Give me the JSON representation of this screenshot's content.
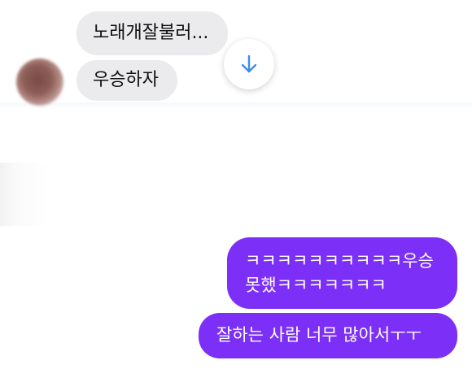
{
  "incoming": {
    "messages": [
      {
        "text": "노래개잘불러..."
      },
      {
        "text": "우승하자"
      }
    ]
  },
  "outgoing": {
    "messages": [
      {
        "lines": [
          "ㅋㅋㅋㅋㅋㅋㅋㅋㅋㅋ우승",
          "못했ㅋㅋㅋㅋㅋㅋㅋ"
        ]
      },
      {
        "text": "잘하는 사람 너무 많아서ㅜㅜ"
      }
    ]
  },
  "controls": {
    "scroll_icon": "arrow-down-icon"
  },
  "colors": {
    "incoming_bubble": "#ebebed",
    "outgoing_bubble": "#7b2ff7",
    "scroll_arrow": "#3d8ce8"
  }
}
